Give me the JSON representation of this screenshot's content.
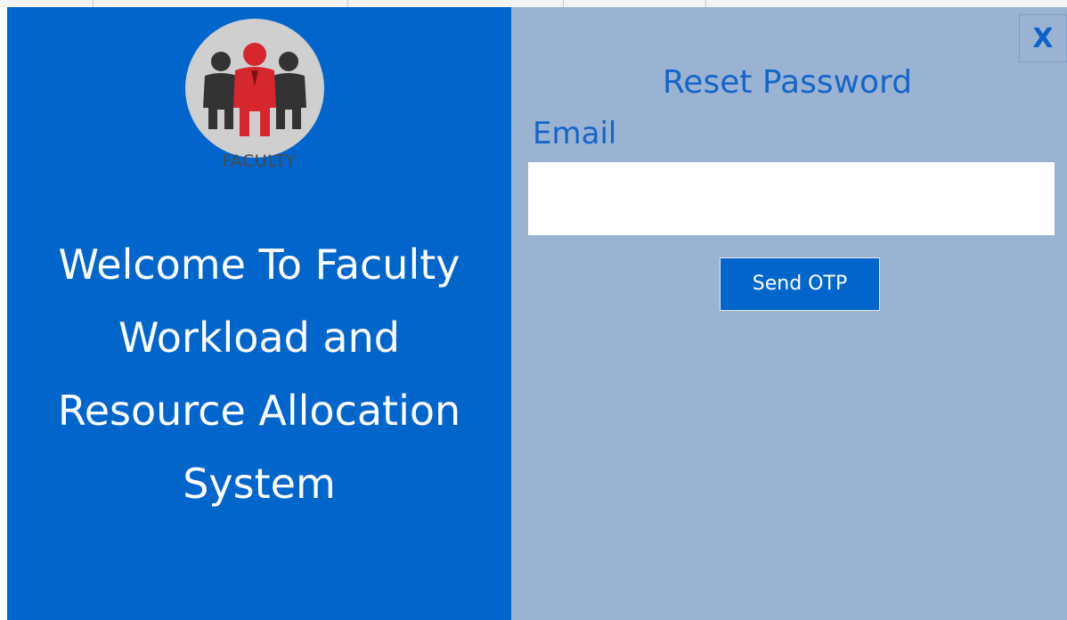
{
  "logo": {
    "icon": "faculty-people-icon",
    "caption": "FACULTY"
  },
  "welcome": {
    "lines": [
      "Welcome To Faculty",
      "Workload and",
      "Resource Allocation",
      "System"
    ]
  },
  "reset": {
    "title": "Reset Password",
    "email_label": "Email",
    "email_value": "",
    "send_label": "Send OTP"
  },
  "window": {
    "close_label": "X"
  },
  "colors": {
    "left_panel": "#0066cc",
    "right_panel": "#9ab3d3",
    "accent_text": "#1565c8",
    "person_accent": "#d6262e"
  }
}
